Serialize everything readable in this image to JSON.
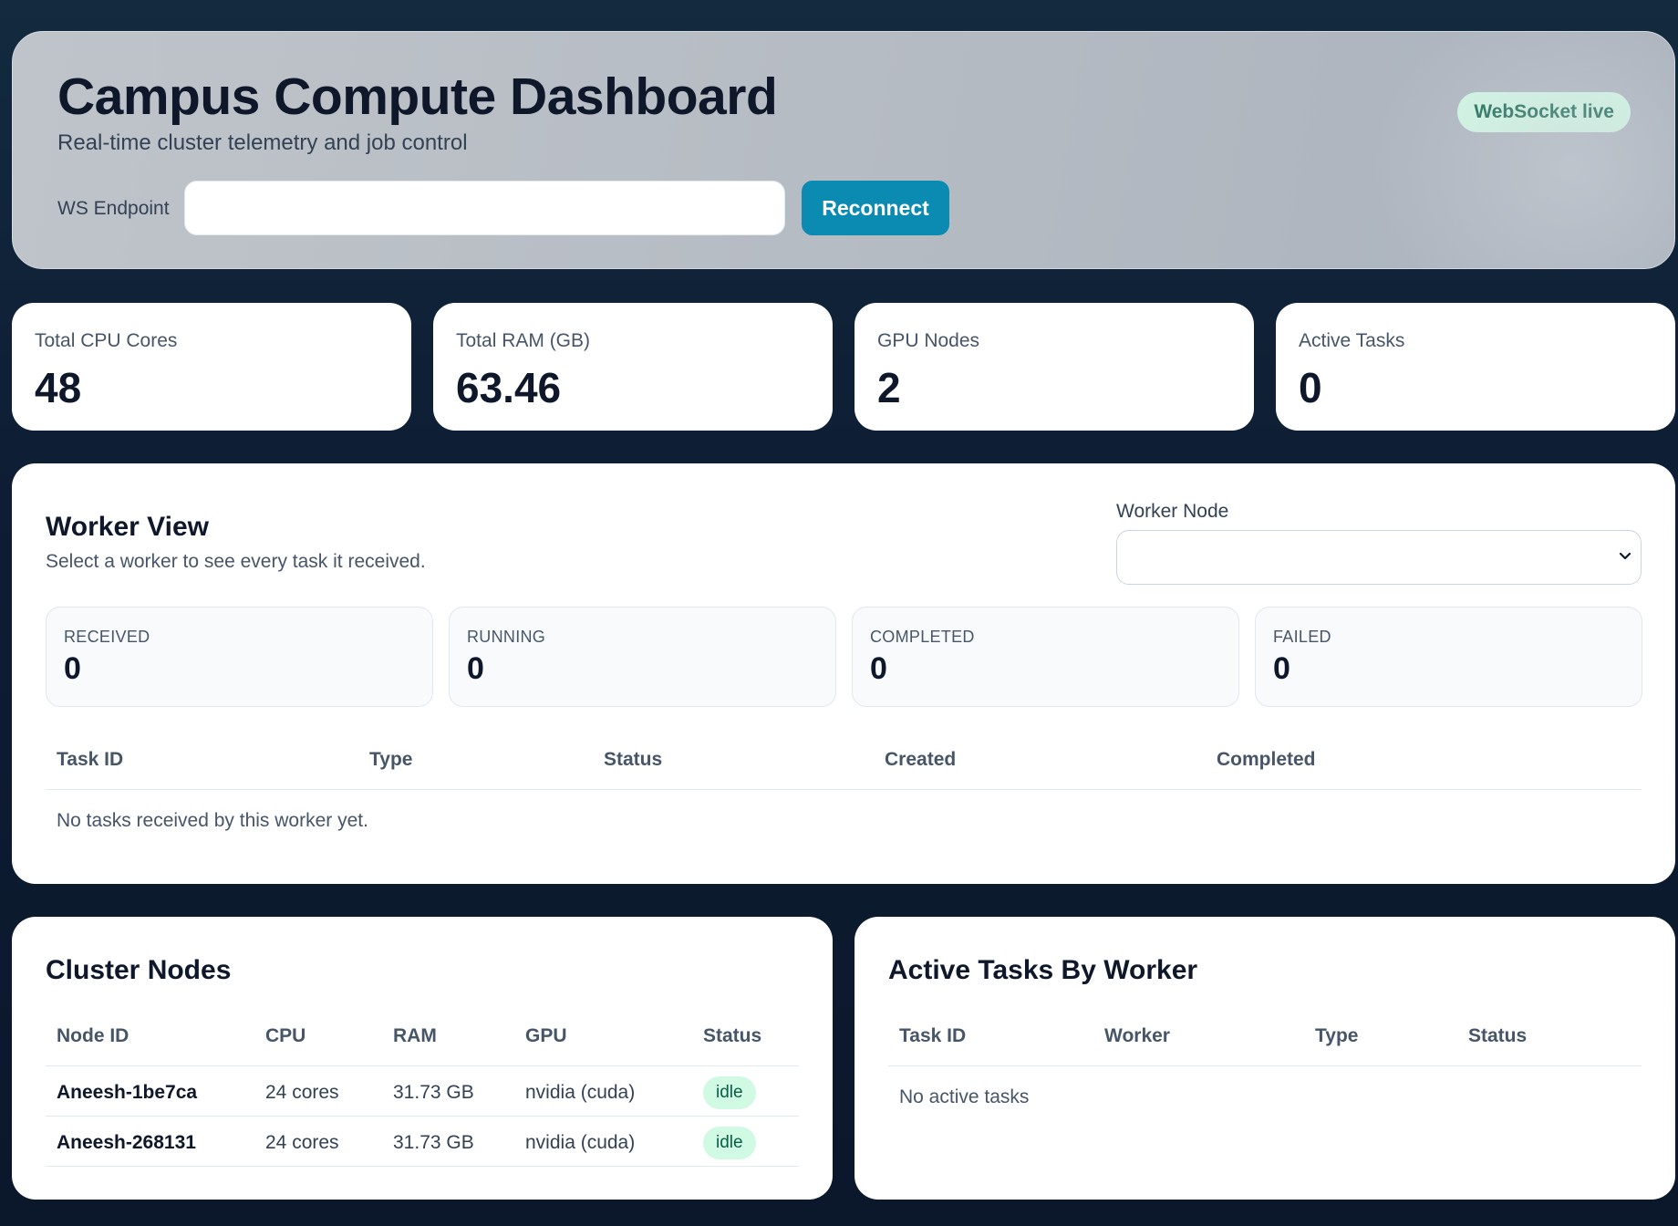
{
  "header": {
    "title": "Campus Compute Dashboard",
    "subtitle": "Real-time cluster telemetry and job control",
    "ws_label": "WS Endpoint",
    "ws_value": "",
    "reconnect_label": "Reconnect",
    "status_badge": "WebSocket live"
  },
  "stats": [
    {
      "label": "Total CPU Cores",
      "value": "48"
    },
    {
      "label": "Total RAM (GB)",
      "value": "63.46"
    },
    {
      "label": "GPU Nodes",
      "value": "2"
    },
    {
      "label": "Active Tasks",
      "value": "0"
    }
  ],
  "worker_view": {
    "title": "Worker View",
    "subtitle": "Select a worker to see every task it received.",
    "select_label": "Worker Node",
    "select_value": "",
    "counters": [
      {
        "label": "RECEIVED",
        "value": "0"
      },
      {
        "label": "RUNNING",
        "value": "0"
      },
      {
        "label": "COMPLETED",
        "value": "0"
      },
      {
        "label": "FAILED",
        "value": "0"
      }
    ],
    "columns": [
      "Task ID",
      "Type",
      "Status",
      "Created",
      "Completed"
    ],
    "empty_text": "No tasks received by this worker yet."
  },
  "cluster_nodes": {
    "title": "Cluster Nodes",
    "columns": [
      "Node ID",
      "CPU",
      "RAM",
      "GPU",
      "Status"
    ],
    "rows": [
      {
        "node_id": "Aneesh-1be7ca",
        "cpu": "24 cores",
        "ram": "31.73 GB",
        "gpu": "nvidia (cuda)",
        "status": "idle"
      },
      {
        "node_id": "Aneesh-268131",
        "cpu": "24 cores",
        "ram": "31.73 GB",
        "gpu": "nvidia (cuda)",
        "status": "idle"
      }
    ]
  },
  "active_tasks": {
    "title": "Active Tasks By Worker",
    "columns": [
      "Task ID",
      "Worker",
      "Type",
      "Status"
    ],
    "empty_text": "No active tasks"
  },
  "colors": {
    "accent": "#0b8ab2",
    "badge_bg": "#d1fae5",
    "badge_text": "#065f46",
    "background": "#0e1d33"
  },
  "icons": {
    "select_chevron": "chevron-down-icon"
  }
}
